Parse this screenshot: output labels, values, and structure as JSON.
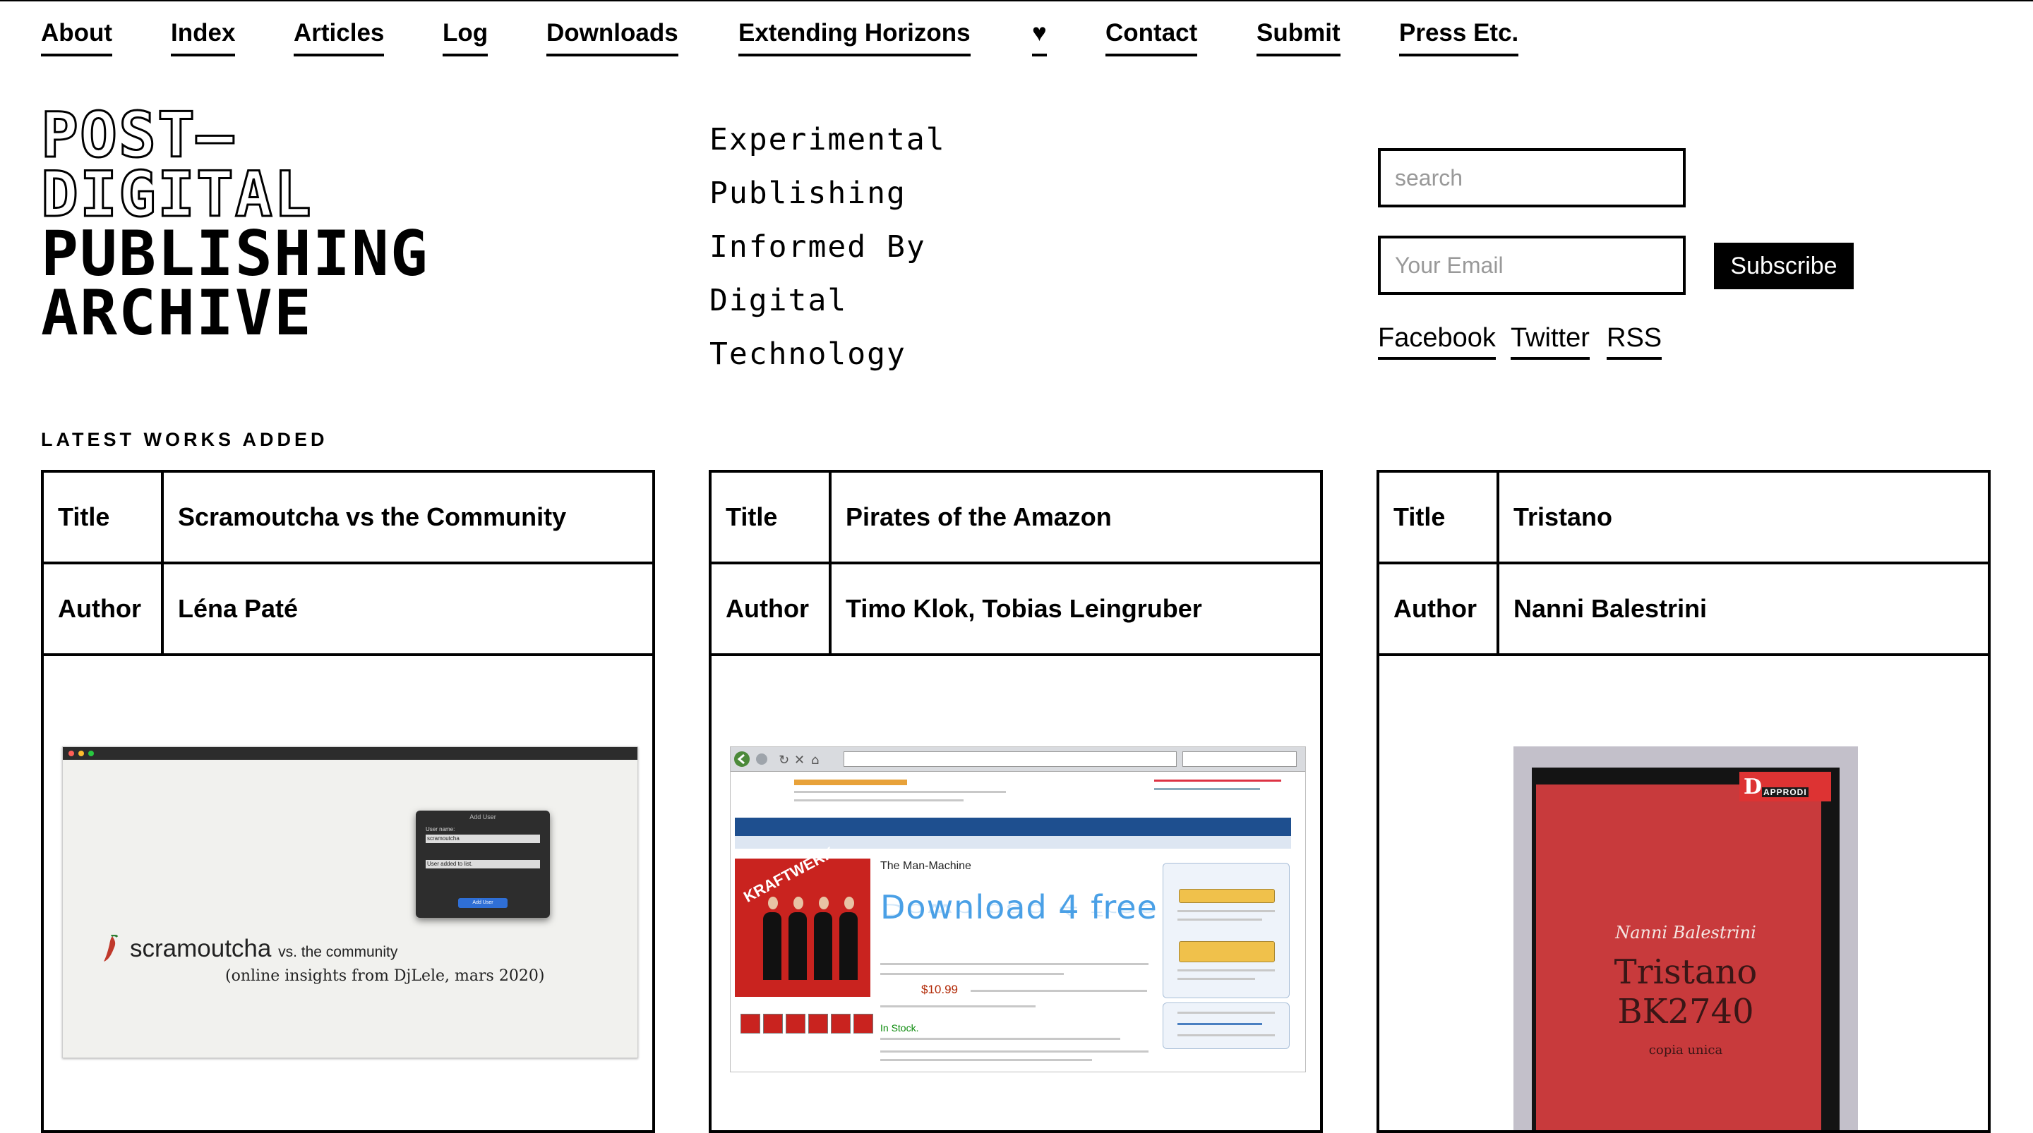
{
  "nav": {
    "items": [
      "About",
      "Index",
      "Articles",
      "Log",
      "Downloads",
      "Extending Horizons",
      "♥",
      "Contact",
      "Submit",
      "Press Etc."
    ]
  },
  "logo": {
    "lines": [
      "POST—",
      "DIGITAL",
      "PUBLISHING",
      "ARCHIVE"
    ]
  },
  "tagline": [
    "Experimental",
    "Publishing",
    "Informed By",
    "Digital",
    "Technology"
  ],
  "search": {
    "placeholder": "search",
    "value": ""
  },
  "newsletter": {
    "email_placeholder": "Your Email",
    "email_value": "",
    "subscribe_label": "Subscribe"
  },
  "social": [
    "Facebook",
    "Twitter",
    "RSS"
  ],
  "latest_heading": "LATEST WORKS ADDED",
  "works": [
    {
      "title_label": "Title",
      "title": "Scramoutcha vs the Community",
      "author_label": "Author",
      "author": "Léna Paté",
      "image": {
        "dialog_title": "Add User",
        "field_label": "User name:",
        "field_value": "scramoutcha",
        "status_text": "User added to list.",
        "button_label": "Add User",
        "word_main": "scramoutcha",
        "word_small": "vs. the community",
        "subtitle": "(online insights from DjLele, mars 2020)"
      }
    },
    {
      "title_label": "Title",
      "title": "Pirates of the Amazon",
      "author_label": "Author",
      "author": "Timo Klok, Tobias Leingruber",
      "image": {
        "cover_text": "KRAFTWERK",
        "product_title": "The Man-Machine",
        "download_text": "Download 4 free",
        "price_text": "$10.99",
        "stock_text": "In Stock."
      }
    },
    {
      "title_label": "Title",
      "title": "Tristano",
      "author_label": "Author",
      "author": "Nanni Balestrini",
      "image": {
        "publisher_initial": "D",
        "publisher_tag": "APPRODI",
        "book_author": "Nanni Balestrini",
        "book_title_1": "Tristano",
        "book_title_2": "BK2740",
        "book_note": "copia unica"
      }
    }
  ],
  "colors": {
    "text": "#000000",
    "background": "#ffffff",
    "button": "#000000"
  }
}
